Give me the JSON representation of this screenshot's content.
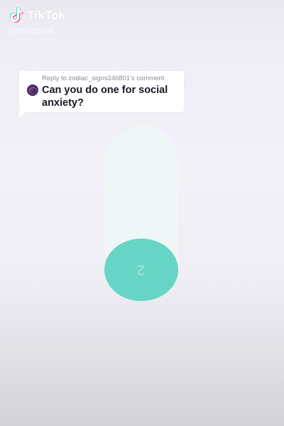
{
  "watermark": {
    "brand": "TikTok",
    "handle": "@breathwrk",
    "logo_icon": "tiktok-logo-icon"
  },
  "reply": {
    "header": "Reply to zodiac_signs246801's comment",
    "text": "Can you do one for social anxiety?",
    "avatar_icon": "commenter-avatar"
  },
  "breath": {
    "count": "2",
    "circle_color": "#66d5c5",
    "track_color": "#eef6f6"
  }
}
